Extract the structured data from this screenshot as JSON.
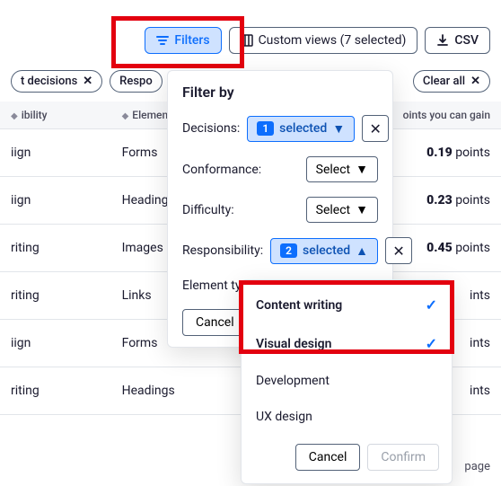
{
  "toolbar": {
    "filters_label": "Filters",
    "custom_views_label": "Custom views (7 selected)",
    "csv_label": "CSV"
  },
  "chips": {
    "decisions_chip": "t decisions",
    "resp_chip": "Respo",
    "clear_all": "Clear all"
  },
  "columns": {
    "resp": "ibility",
    "elem": "Element type",
    "points": "oints you can gain"
  },
  "rows": [
    {
      "resp": "iign",
      "elem": "Forms",
      "pts": "0.19",
      "suffix": "points"
    },
    {
      "resp": "iign",
      "elem": "Headings",
      "pts": "0.23",
      "suffix": "points"
    },
    {
      "resp": "riting",
      "elem": "Images",
      "pts": "0.45",
      "suffix": "points"
    },
    {
      "resp": "riting",
      "elem": "Links",
      "pts": "",
      "suffix": "ints"
    },
    {
      "resp": "iign",
      "elem": "Forms",
      "pts": "",
      "suffix": "ints"
    },
    {
      "resp": "riting",
      "elem": "Headings",
      "pts": "",
      "suffix": "ints"
    }
  ],
  "popover": {
    "title": "Filter by",
    "decisions_label": "Decisions:",
    "conformance_label": "Conformance:",
    "difficulty_label": "Difficulty:",
    "responsibility_label": "Responsibility:",
    "element_type_label": "Element type:",
    "select_label": "Select",
    "selected_label": "selected",
    "decisions_count": "1",
    "responsibility_count": "2",
    "cancel_label": "Cancel"
  },
  "resp_dropdown": {
    "options": [
      {
        "label": "Content writing",
        "selected": true
      },
      {
        "label": "Visual design",
        "selected": true
      },
      {
        "label": "Development",
        "selected": false
      },
      {
        "label": "UX design",
        "selected": false
      }
    ],
    "cancel_label": "Cancel",
    "confirm_label": "Confirm"
  },
  "footer": {
    "page_text": "page"
  }
}
